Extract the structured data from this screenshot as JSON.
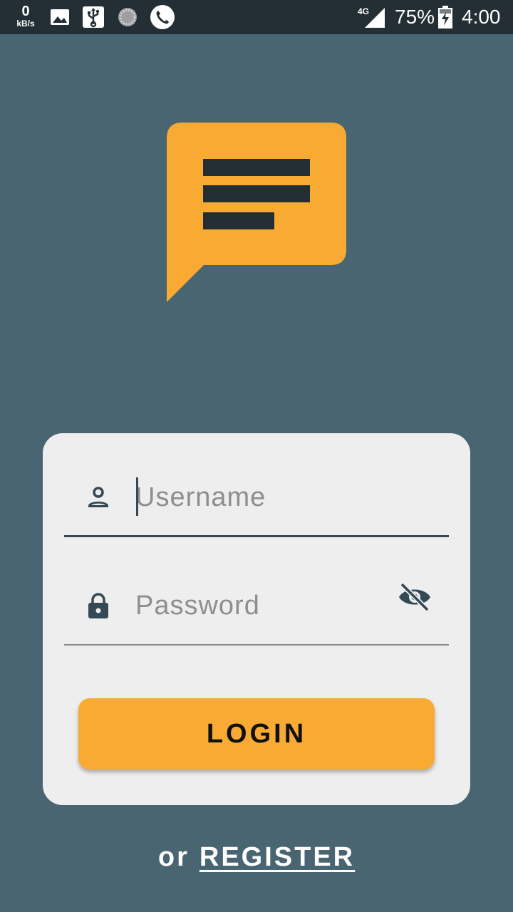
{
  "status_bar": {
    "speed_value": "0",
    "speed_unit": "kB/s",
    "icons": [
      "image-icon",
      "usb-icon",
      "sync-icon",
      "phone-icon"
    ],
    "network_type": "4G",
    "battery_percent": "75%",
    "time": "4:00"
  },
  "logo": {
    "icon": "chat-bubble-icon",
    "color": "#f9aa33"
  },
  "login_form": {
    "username": {
      "placeholder": "Username",
      "value": "",
      "icon": "person-icon"
    },
    "password": {
      "placeholder": "Password",
      "value": "",
      "icon": "lock-icon",
      "toggle_icon": "eye-off-icon"
    },
    "login_label": "LOGIN"
  },
  "footer": {
    "prefix": "or",
    "register_label": "REGISTER"
  },
  "colors": {
    "background": "#4a6572",
    "status_bar": "#232f34",
    "accent": "#f9aa33",
    "card": "#eeeeee",
    "dark": "#344955"
  }
}
